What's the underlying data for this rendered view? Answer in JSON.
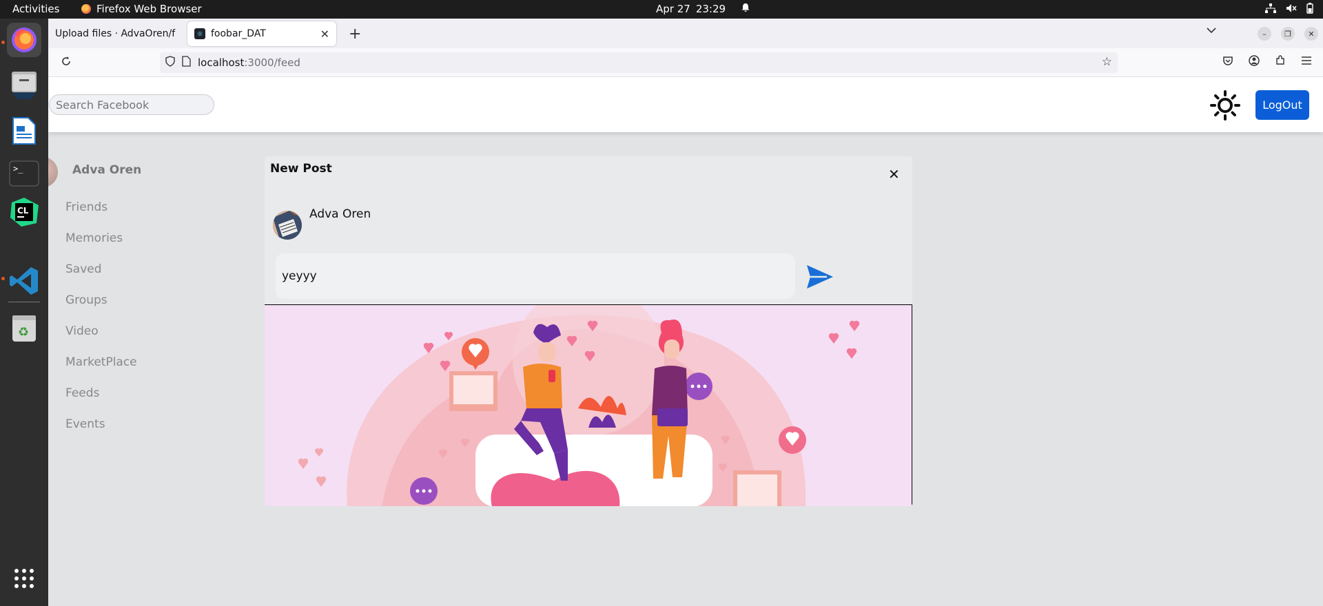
{
  "topbar": {
    "activities": "Activities",
    "app_name": "Firefox Web Browser",
    "date": "Apr 27",
    "time": "23:29"
  },
  "dock": {
    "items": [
      "firefox-icon",
      "files-icon",
      "writer-icon",
      "terminal-icon",
      "clion-icon",
      "vscode-icon",
      "trash-icon",
      "apps-grid-icon"
    ]
  },
  "browser": {
    "tabs": [
      {
        "title": "Upload files · AdvaOren/f",
        "active": false
      },
      {
        "title": "foobar_DAT",
        "active": true
      }
    ],
    "url_host": "localhost",
    "url_path": ":3000/feed"
  },
  "header": {
    "search_placeholder": "Search Facebook",
    "logout_label": "LogOut"
  },
  "sidebar": {
    "profile_name": "Adva Oren",
    "items": [
      "Friends",
      "Memories",
      "Saved",
      "Groups",
      "Video",
      "MarketPlace",
      "Feeds",
      "Events"
    ]
  },
  "modal": {
    "title": "New Post",
    "close_symbol": "✕",
    "author": "Adva Oren",
    "post_text": "yeyyy"
  },
  "colors": {
    "logout_bg": "#0b5ed7",
    "send_arrow": "#1a6fd6",
    "image_bg": "#f5dff5"
  }
}
